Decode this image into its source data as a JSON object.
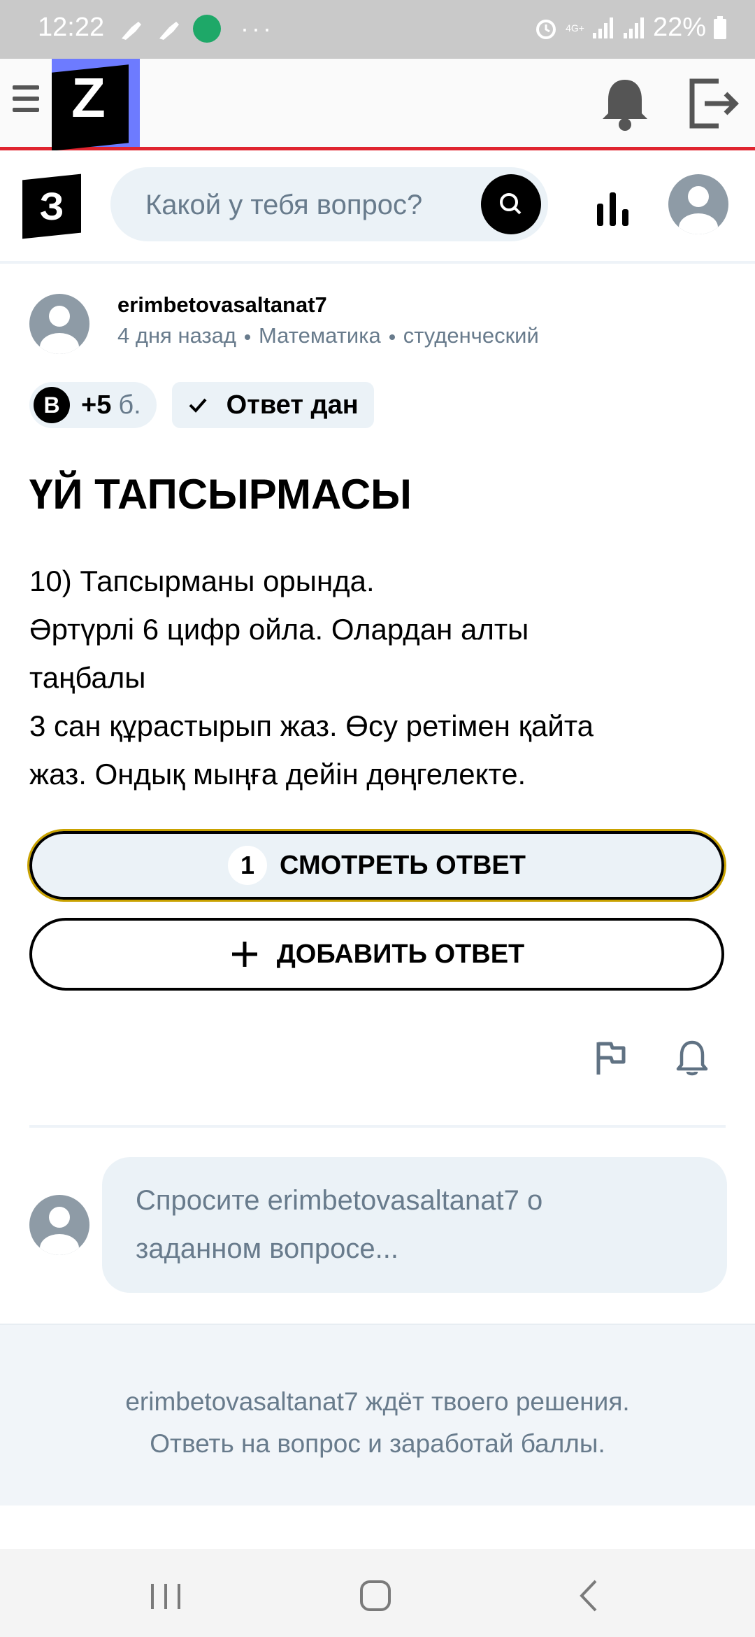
{
  "status_bar": {
    "time": "12:22",
    "more": "···",
    "network": "4G+",
    "battery": "22%"
  },
  "header": {
    "logo_letter": "Z",
    "icons": [
      "menu-icon",
      "bell-icon",
      "logout-icon"
    ]
  },
  "search": {
    "logo_letter": "З",
    "placeholder": "Какой у тебя вопрос?"
  },
  "question": {
    "author": "erimbetovasaltanat7",
    "time_ago": "4 дня назад",
    "subject": "Математика",
    "level": "студенческий",
    "points_badge_letter": "B",
    "points": "+5",
    "points_unit": "б.",
    "answered_label": "Ответ дан",
    "title": "ҮЙ ТАПСЫРМАСЫ",
    "text_lines": [
      "10) Тапсырманы орында.",
      "Әртүрлі 6 цифр ойла. Олардан алты",
      "таңбалы",
      "3 сан құрастырып жаз. Өсу ретімен қайта",
      "жаз. Ондық мыңға дейін дөңгелекте."
    ]
  },
  "actions": {
    "answers_count": "1",
    "view_answer_label": "СМОТРЕТЬ ОТВЕТ",
    "add_answer_label": "ДОБАВИТЬ ОТВЕТ"
  },
  "comment": {
    "placeholder_line1": "Спросите erimbetovasaltanat7 о",
    "placeholder_line2": "заданном вопросе..."
  },
  "invite": {
    "line1": "erimbetovasaltanat7 ждёт твоего решения.",
    "line2": "Ответь на вопрос и заработай баллы."
  },
  "colors": {
    "accent_red": "#e0242f",
    "logo_blue": "#6d7bff",
    "light_bg": "#ebf2f7",
    "muted_text": "#687b8c",
    "focus_outline": "#c9a200"
  }
}
